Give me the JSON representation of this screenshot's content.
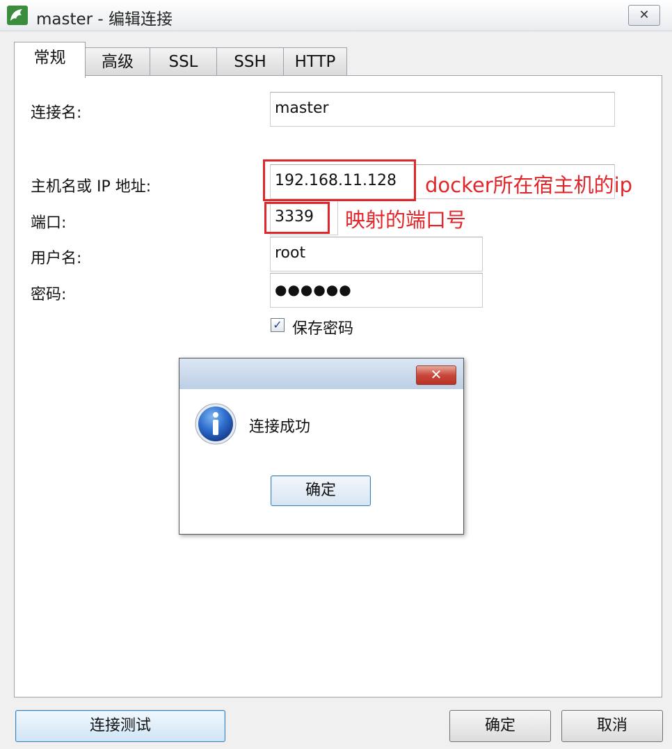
{
  "window": {
    "title": "master - 编辑连接",
    "close_label": "✕"
  },
  "tabs": [
    {
      "label": "常规"
    },
    {
      "label": "高级"
    },
    {
      "label": "SSL"
    },
    {
      "label": "SSH"
    },
    {
      "label": "HTTP"
    }
  ],
  "form": {
    "connection_name_label": "连接名:",
    "connection_name_value": "master",
    "host_label": "主机名或 IP 地址:",
    "host_value": "192.168.11.128",
    "port_label": "端口:",
    "port_value": "3339",
    "user_label": "用户名:",
    "user_value": "root",
    "password_label": "密码:",
    "password_value": "●●●●●●",
    "save_password_label": "保存密码",
    "save_password_checked": "✓"
  },
  "annotations": {
    "host_note": "docker所在宿主机的ip",
    "port_note": "映射的端口号",
    "color": "#e0252b"
  },
  "message_box": {
    "close_label": "✕",
    "text": "连接成功",
    "ok_label": "确定",
    "icon": "info-icon"
  },
  "buttons": {
    "test_label": "连接测试",
    "ok_label": "确定",
    "cancel_label": "取消"
  }
}
